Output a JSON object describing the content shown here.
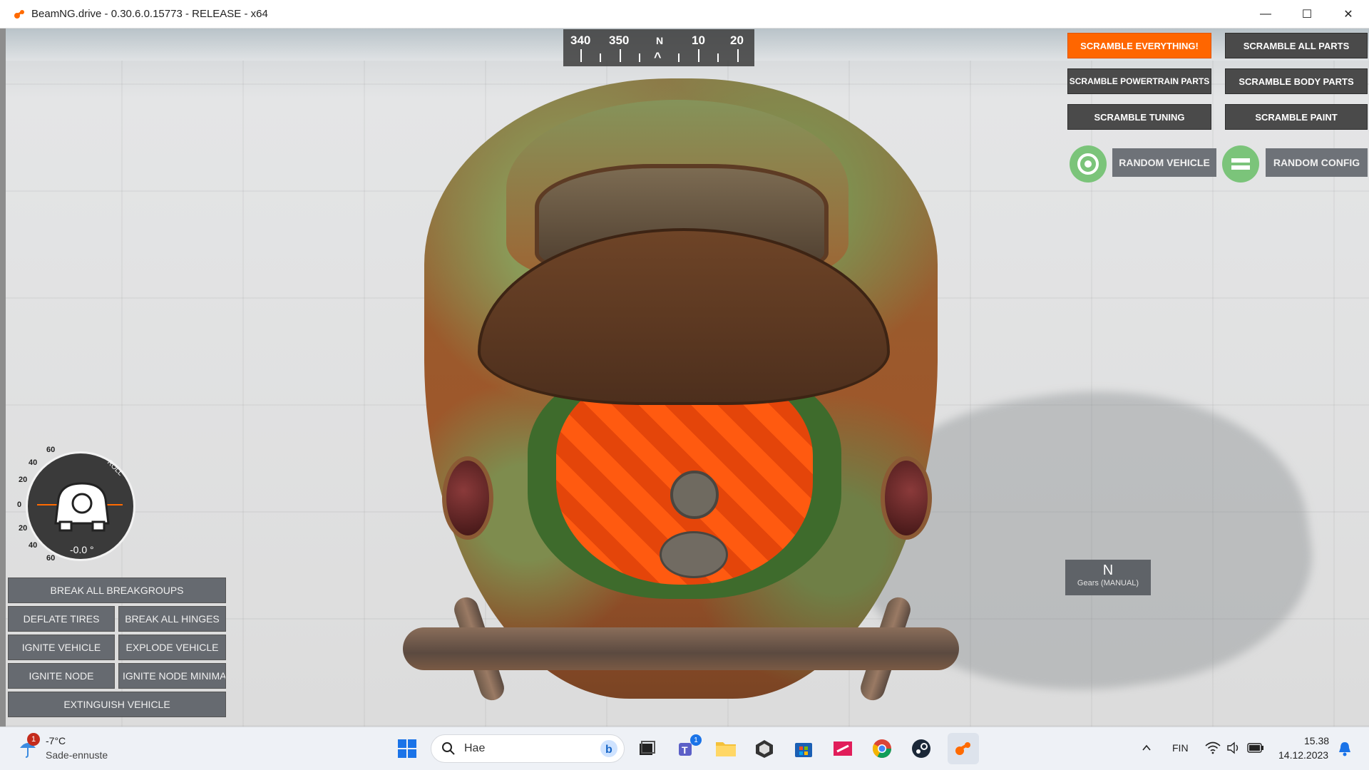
{
  "window": {
    "title": "BeamNG.drive - 0.30.6.0.15773 - RELEASE - x64",
    "controls": {
      "minimize": "—",
      "maximize": "☐",
      "close": "✕"
    }
  },
  "compass": {
    "labels": [
      "340",
      "350",
      "N",
      "10",
      "20"
    ],
    "needle": "^"
  },
  "scramble": {
    "everything": "SCRAMBLE EVERYTHING!",
    "all_parts": "SCRAMBLE ALL PARTS",
    "powertrain": "SCRAMBLE POWERTRAIN PARTS",
    "body": "SCRAMBLE BODY PARTS",
    "tuning": "SCRAMBLE TUNING",
    "paint": "SCRAMBLE PAINT",
    "accent": "#ff6600"
  },
  "random": {
    "vehicle": "RANDOM VEHICLE",
    "config": "RANDOM CONFIG",
    "icon_color": "#7bc47a"
  },
  "gauge": {
    "labels": [
      "60",
      "40",
      "20",
      "0",
      "20",
      "40",
      "60"
    ],
    "axis": "ROLL",
    "value": "-0.0 °",
    "redline_color": "#ff6a00"
  },
  "actions": {
    "break_groups": "BREAK ALL BREAKGROUPS",
    "deflate": "DEFLATE TIRES",
    "break_hinges": "BREAK ALL HINGES",
    "ignite_vehicle": "IGNITE VEHICLE",
    "explode": "EXPLODE VEHICLE",
    "ignite_node": "IGNITE NODE",
    "ignite_node_min": "IGNITE NODE MINIMA",
    "extinguish": "EXTINGUISH VEHICLE"
  },
  "gear": {
    "value": "N",
    "mode": "Gears (MANUAL)"
  },
  "taskbar": {
    "weather_temp": "-7°C",
    "weather_desc": "Sade-ennuste",
    "weather_badge": "1",
    "search_placeholder": "Hae",
    "teams_badge": "1",
    "language": "FIN",
    "time": "15.38",
    "date": "14.12.2023",
    "apps": [
      "windows-start",
      "search",
      "bing",
      "task-view",
      "teams",
      "file-explorer",
      "unity",
      "microsoft-store",
      "forza",
      "chrome",
      "steam",
      "beamng"
    ]
  }
}
